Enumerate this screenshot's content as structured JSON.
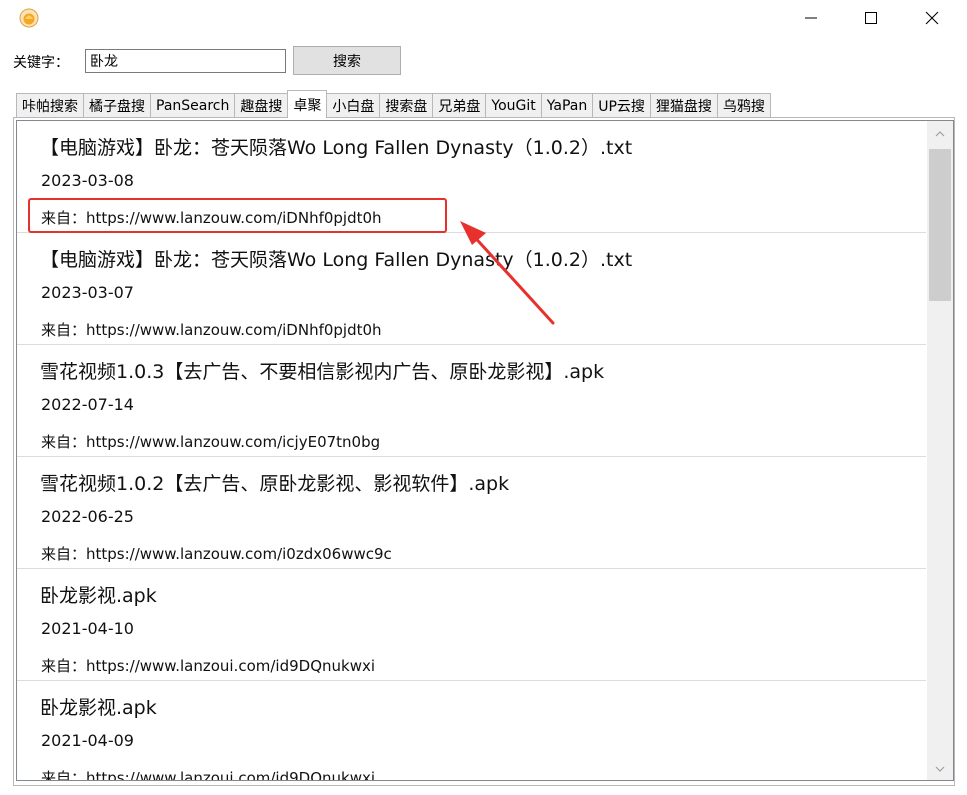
{
  "search": {
    "label": "关键字：",
    "value": "卧龙",
    "button_label": "搜索"
  },
  "tabs": [
    {
      "label": "咔帕搜索",
      "active": false
    },
    {
      "label": "橘子盘搜",
      "active": false
    },
    {
      "label": "PanSearch",
      "active": false
    },
    {
      "label": "趣盘搜",
      "active": false
    },
    {
      "label": "卓聚",
      "active": true
    },
    {
      "label": "小白盘",
      "active": false
    },
    {
      "label": "搜索盘",
      "active": false
    },
    {
      "label": "兄弟盘",
      "active": false
    },
    {
      "label": "YouGit",
      "active": false
    },
    {
      "label": "YaPan",
      "active": false
    },
    {
      "label": "UP云搜",
      "active": false
    },
    {
      "label": "狸猫盘搜",
      "active": false
    },
    {
      "label": "乌鸦搜",
      "active": false
    }
  ],
  "results": [
    {
      "title": "【电脑游戏】卧龙：苍天陨落Wo Long Fallen Dynasty（1.0.2）.txt",
      "date": "2023-03-08",
      "source": "来自：https://www.lanzouw.com/iDNhf0pjdt0h"
    },
    {
      "title": "【电脑游戏】卧龙：苍天陨落Wo Long Fallen Dynasty（1.0.2）.txt",
      "date": "2023-03-07",
      "source": "来自：https://www.lanzouw.com/iDNhf0pjdt0h"
    },
    {
      "title": "雪花视频1.0.3【去广告、不要相信影视内广告、原卧龙影视】.apk",
      "date": "2022-07-14",
      "source": "来自：https://www.lanzouw.com/icjyE07tn0bg"
    },
    {
      "title": "雪花视频1.0.2【去广告、原卧龙影视、影视软件】.apk",
      "date": "2022-06-25",
      "source": "来自：https://www.lanzouw.com/i0zdx06wwc9c"
    },
    {
      "title": "卧龙影视.apk",
      "date": "2021-04-10",
      "source": "来自：https://www.lanzoui.com/id9DQnukwxi"
    },
    {
      "title": "卧龙影视.apk",
      "date": "2021-04-09",
      "source": "来自：https://www.lanzoui.com/id9DQnukwxi"
    }
  ],
  "colors": {
    "annotation": "#e8302d",
    "app_icon": "#f5a623"
  },
  "icons": {
    "app": "app-logo-icon",
    "minimize": "minimize-icon",
    "maximize": "maximize-icon",
    "close": "close-icon",
    "scroll_up": "chevron-up-icon",
    "scroll_down": "chevron-down-icon"
  }
}
